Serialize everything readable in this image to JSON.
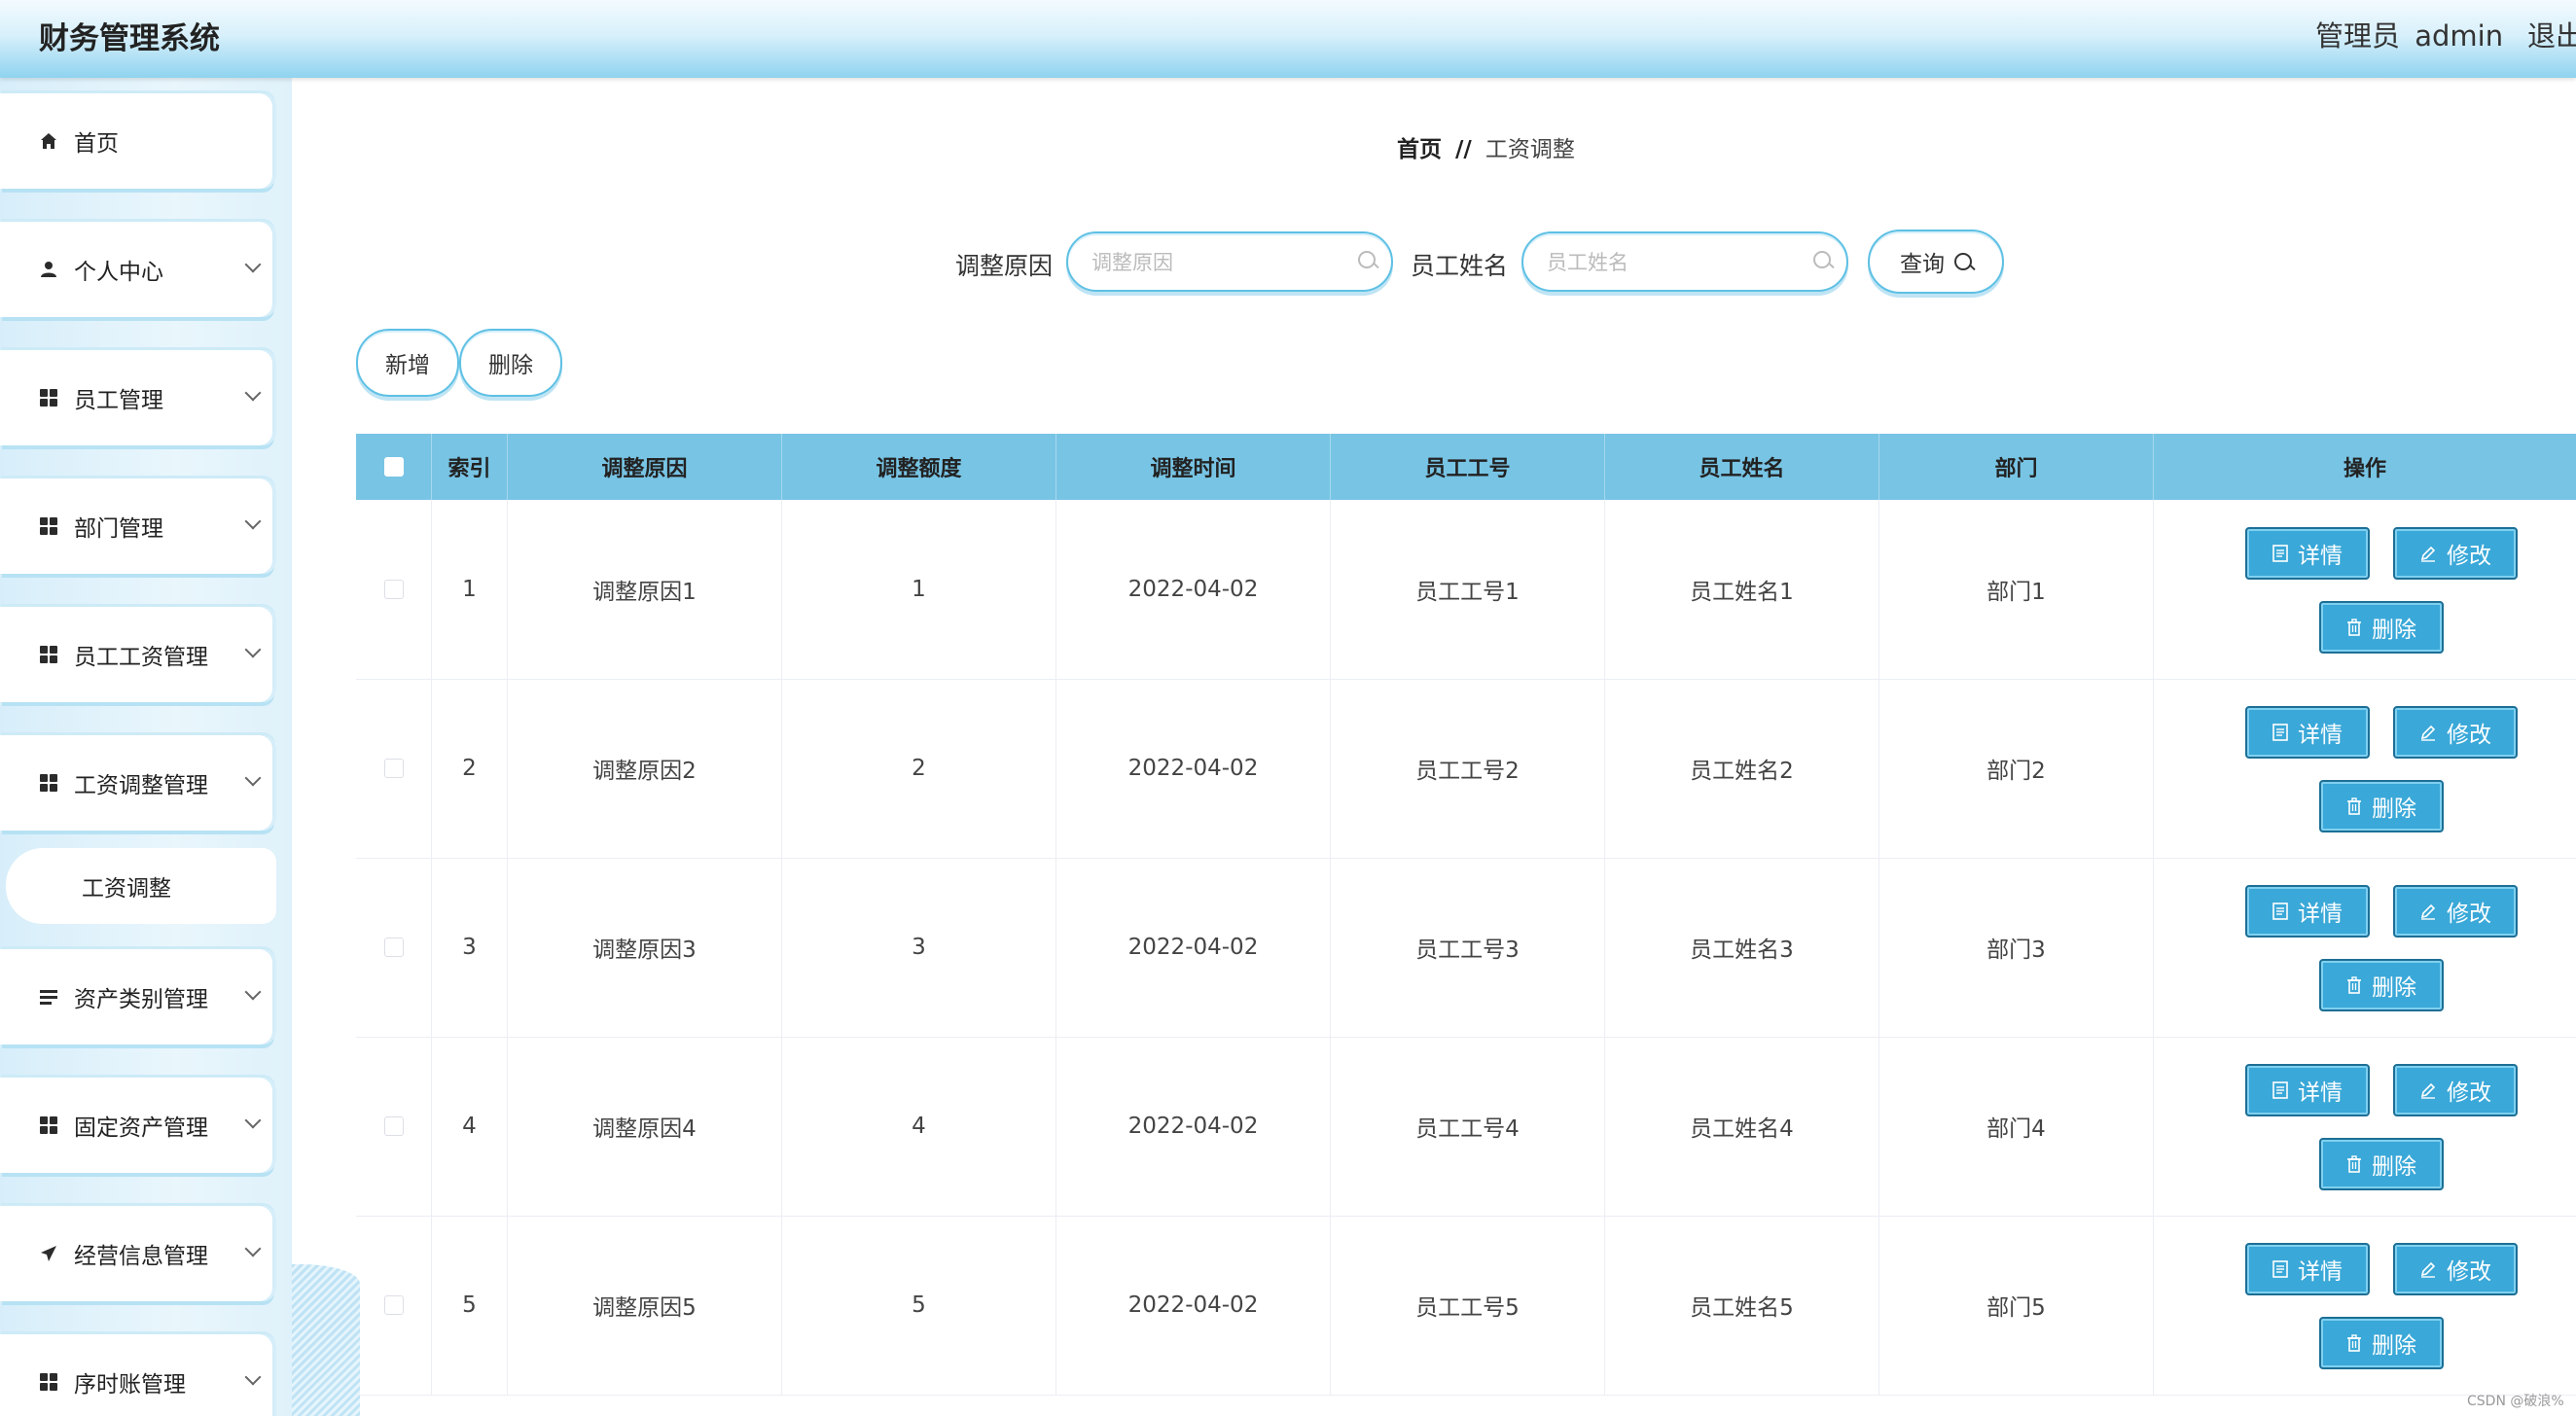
{
  "header": {
    "title": "财务管理系统",
    "role": "管理员",
    "username": "admin",
    "logout": "退出"
  },
  "sidebar": {
    "items": [
      {
        "label": "首页",
        "icon": "home-icon"
      },
      {
        "label": "个人中心",
        "icon": "user-icon"
      },
      {
        "label": "员工管理",
        "icon": "grid-icon"
      },
      {
        "label": "部门管理",
        "icon": "grid-icon"
      },
      {
        "label": "员工工资管理",
        "icon": "grid-icon"
      },
      {
        "label": "工资调整管理",
        "icon": "grid-icon",
        "expanded": true
      },
      {
        "label": "资产类别管理",
        "icon": "list-icon"
      },
      {
        "label": "固定资产管理",
        "icon": "grid-icon"
      },
      {
        "label": "经营信息管理",
        "icon": "send-icon"
      },
      {
        "label": "序时账管理",
        "icon": "grid-icon"
      }
    ],
    "sub_item": "工资调整"
  },
  "breadcrumb": {
    "home": "首页",
    "sep": "//",
    "current": "工资调整"
  },
  "search": {
    "field1_label": "调整原因",
    "field1_placeholder": "调整原因",
    "field1_value": "",
    "field2_label": "员工姓名",
    "field2_placeholder": "员工姓名",
    "field2_value": "",
    "query_label": "查询"
  },
  "toolbar": {
    "add_label": "新增",
    "delete_label": "删除"
  },
  "table": {
    "headers": [
      "索引",
      "调整原因",
      "调整额度",
      "调整时间",
      "员工工号",
      "员工姓名",
      "部门",
      "操作"
    ],
    "rows": [
      {
        "index": "1",
        "reason": "调整原因1",
        "amount": "1",
        "time": "2022-04-02",
        "emp_no": "员工工号1",
        "emp_name": "员工姓名1",
        "dept": "部门1"
      },
      {
        "index": "2",
        "reason": "调整原因2",
        "amount": "2",
        "time": "2022-04-02",
        "emp_no": "员工工号2",
        "emp_name": "员工姓名2",
        "dept": "部门2"
      },
      {
        "index": "3",
        "reason": "调整原因3",
        "amount": "3",
        "time": "2022-04-02",
        "emp_no": "员工工号3",
        "emp_name": "员工姓名3",
        "dept": "部门3"
      },
      {
        "index": "4",
        "reason": "调整原因4",
        "amount": "4",
        "time": "2022-04-02",
        "emp_no": "员工工号4",
        "emp_name": "员工姓名4",
        "dept": "部门4"
      },
      {
        "index": "5",
        "reason": "调整原因5",
        "amount": "5",
        "time": "2022-04-02",
        "emp_no": "员工工号5",
        "emp_name": "员工姓名5",
        "dept": "部门5"
      }
    ],
    "actions": {
      "detail": "详情",
      "edit": "修改",
      "delete": "删除"
    }
  },
  "watermark": "CSDN @破浪%",
  "colors": {
    "header_accent": "#8fd3ef",
    "table_header": "#78c4e4",
    "action_button": "#3aa8d8"
  }
}
